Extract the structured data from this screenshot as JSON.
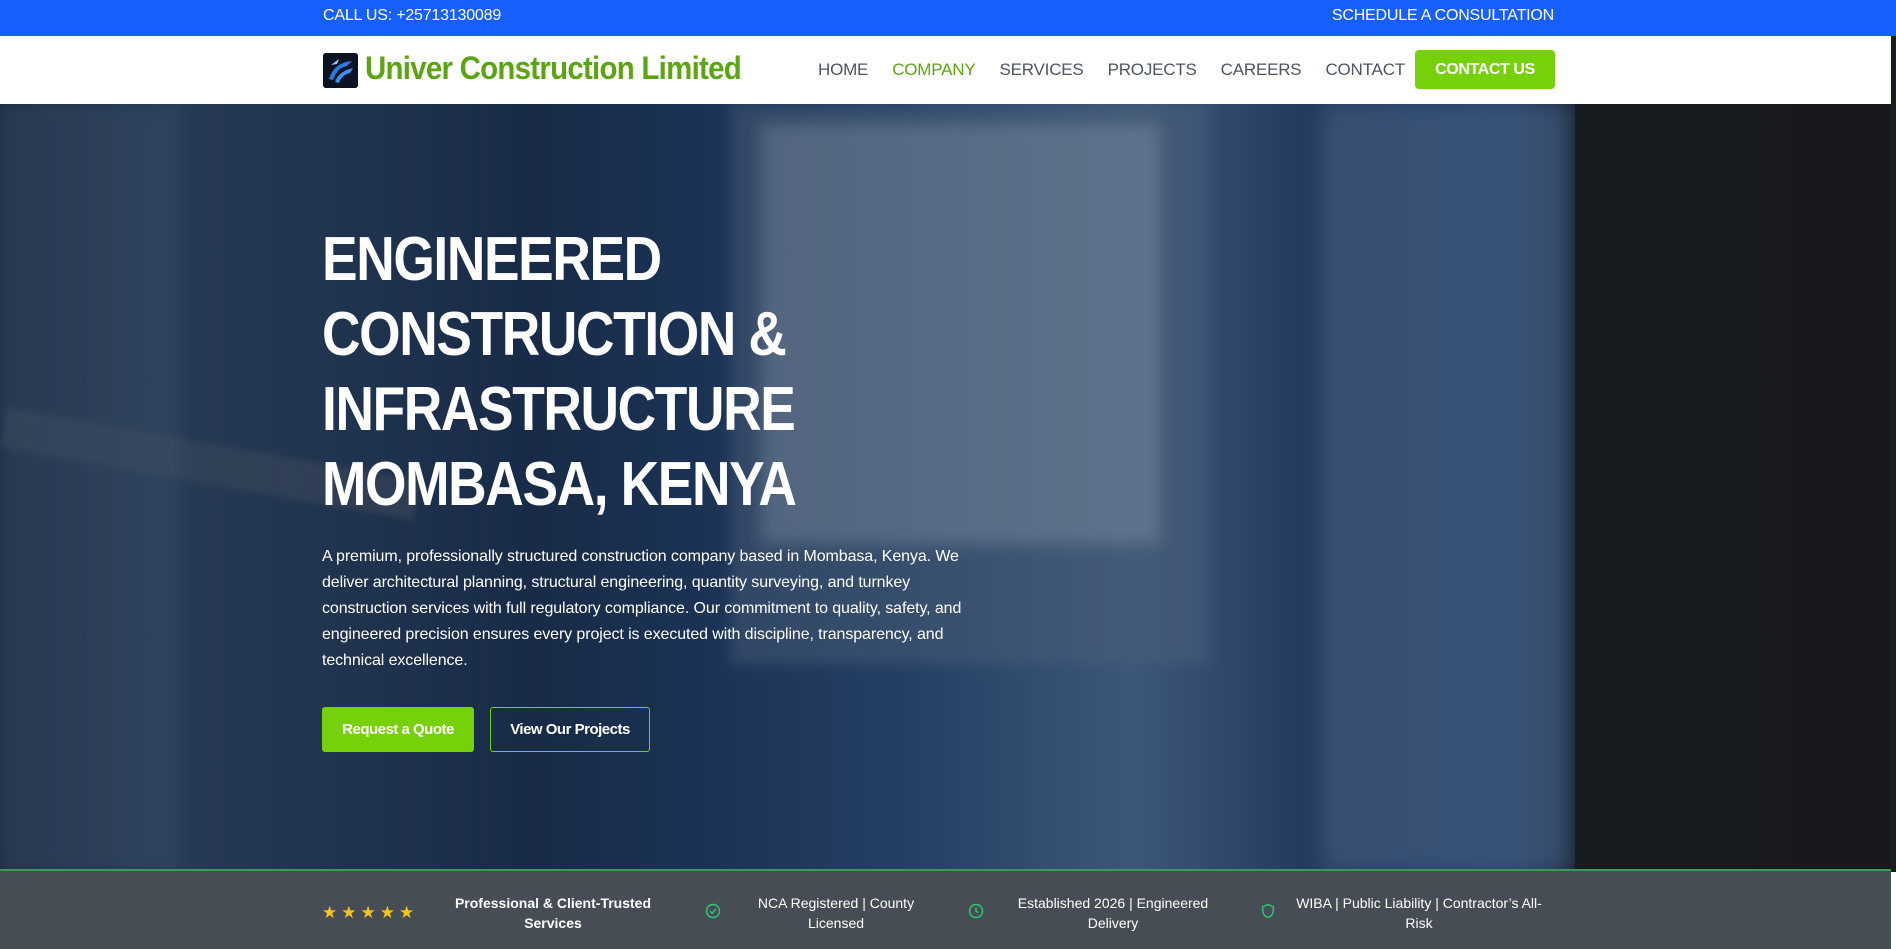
{
  "topbar": {
    "call": "CALL US: +25713130089",
    "schedule": "SCHEDULE A CONSULTATION"
  },
  "header": {
    "logo_text": "Univer Construction Limited",
    "nav": [
      "HOME",
      "COMPANY",
      "SERVICES",
      "PROJECTS",
      "CAREERS",
      "CONTACT"
    ],
    "active_nav": "COMPANY",
    "contact_button": "CONTACT US"
  },
  "hero": {
    "title_lines": [
      "ENGINEERED",
      "CONSTRUCTION &",
      "INFRASTRUCTURE",
      "MOMBASA, KENYA"
    ],
    "description": "A premium, professionally structured construction company based in Mombasa, Kenya. We deliver architectural planning, structural engineering, quantity surveying, and turnkey construction services with full regulatory compliance. Our commitment to quality, safety, and engineered precision ensures every project is executed with discipline, transparency, and technical excellence.",
    "primary_button": "Request a Quote",
    "secondary_button": "View Our Projects"
  },
  "trust": {
    "stars": 5,
    "items": [
      "Professional & Client-Trusted Services",
      "NCA Registered | County Licensed",
      "Established 2026 | Engineered Delivery",
      "WIBA | Public Liability | Contractor’s All-Risk"
    ],
    "icons": [
      "check-circle-icon",
      "clock-icon",
      "shield-icon"
    ]
  },
  "colors": {
    "topbar": "#1760ff",
    "accent_green": "#76d10a",
    "logo_green": "#5ba512",
    "trust_bg": "#474d55",
    "star": "#f5c518"
  }
}
